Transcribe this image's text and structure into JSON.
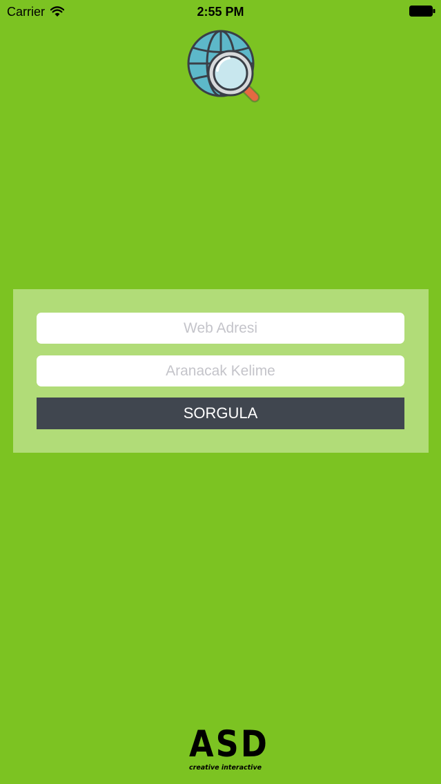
{
  "status_bar": {
    "carrier": "Carrier",
    "time": "2:55 PM",
    "wifi_icon": "wifi-icon",
    "battery_icon": "battery-icon"
  },
  "logo": {
    "icon": "globe-magnifier-icon"
  },
  "form": {
    "web_address_placeholder": "Web Adresi",
    "web_address_value": "",
    "keyword_placeholder": "Aranacak Kelime",
    "keyword_value": "",
    "submit_label": "SORGULA"
  },
  "brand": {
    "letters": "ASD",
    "tagline": "creative interactive"
  },
  "colors": {
    "background": "#7cc322",
    "panel": "#b1dc78",
    "button": "#40464f",
    "input_background": "#ffffff",
    "placeholder": "#c4c4ca"
  }
}
